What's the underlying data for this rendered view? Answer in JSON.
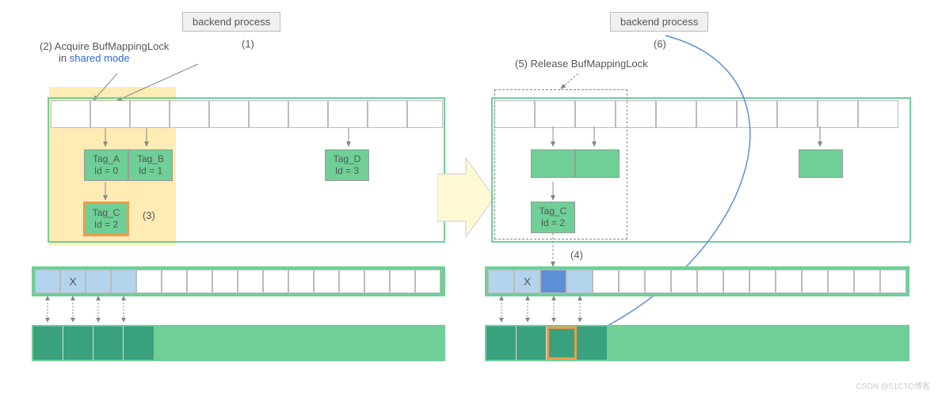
{
  "left": {
    "backend_label": "backend  process",
    "step1": "(1)",
    "step2_prefix": "(2) Acquire BufMappingLock",
    "step2_indent": "in ",
    "step2_link": "shared mode",
    "step3": "(3)",
    "tags": {
      "A": {
        "name": "Tag_A",
        "id": "Id = 0"
      },
      "B": {
        "name": "Tag_B",
        "id": "Id = 1"
      },
      "C": {
        "name": "Tag_C",
        "id": "Id = 2"
      },
      "D": {
        "name": "Tag_D",
        "id": "Id = 3"
      }
    },
    "desc_x": "X"
  },
  "right": {
    "backend_label": "backend  process",
    "step4": "(4)",
    "step5": "(5) Release BufMappingLock",
    "step6": "(6)",
    "tagC": {
      "name": "Tag_C",
      "id": "Id = 2"
    },
    "desc_x": "X"
  },
  "credit": "CSDN @51CTO博客"
}
